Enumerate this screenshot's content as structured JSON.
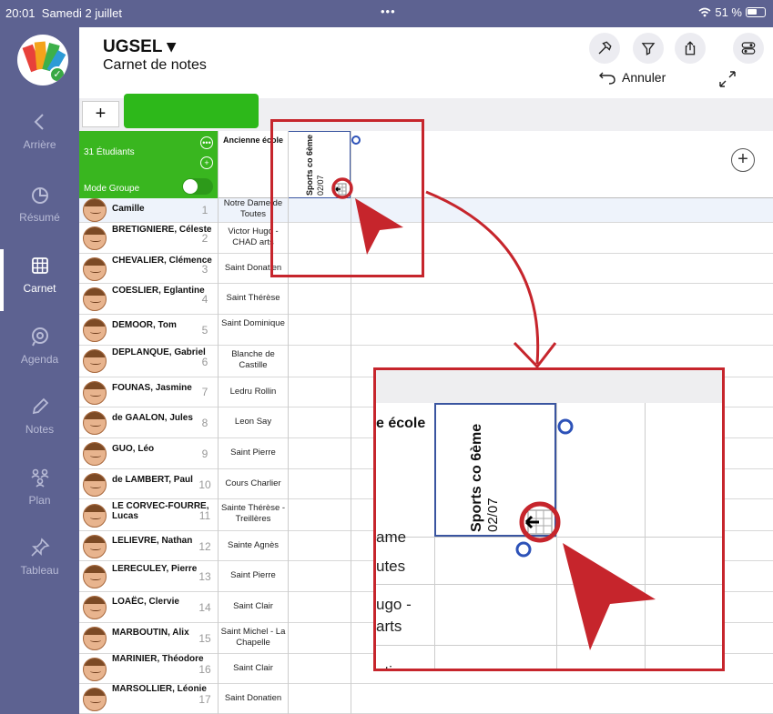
{
  "status_bar": {
    "time": "20:01",
    "date": "Samedi 2 juillet",
    "dots": "•••",
    "battery": "51 %"
  },
  "sidebar": {
    "items": [
      {
        "label": "Arrière",
        "icon": "chevron-left-icon"
      },
      {
        "label": "Résumé",
        "icon": "pie-chart-icon"
      },
      {
        "label": "Carnet",
        "icon": "grid-icon"
      },
      {
        "label": "Agenda",
        "icon": "agenda-icon"
      },
      {
        "label": "Notes",
        "icon": "pencil-icon"
      },
      {
        "label": "Plan",
        "icon": "people-icon"
      },
      {
        "label": "Tableau",
        "icon": "pin-icon"
      }
    ]
  },
  "header": {
    "title": "UGSEL ▾",
    "subtitle": "Carnet de notes",
    "undo_label": "Annuler"
  },
  "toolbar": {
    "plus": "+"
  },
  "group_panel": {
    "count": "31 Étudiants",
    "mode": "Mode Groupe",
    "more": "•••",
    "add": "+"
  },
  "columns": {
    "school_header": "Ancienne école",
    "assignment_title": "Sports co 6ème",
    "assignment_date": "02/07",
    "add_column": "+"
  },
  "students": [
    {
      "name": "Camille",
      "num": "1",
      "school": "Notre Dame de Toutes"
    },
    {
      "name": "BRETIGNIERE, Céleste",
      "num": "2",
      "school": "Victor Hugo - CHAD arts"
    },
    {
      "name": "CHEVALIER, Clémence",
      "num": "3",
      "school": "Saint Donatien"
    },
    {
      "name": "COESLIER, Eglantine",
      "num": "4",
      "school": "Saint Thérèse"
    },
    {
      "name": "DEMOOR, Tom",
      "num": "5",
      "school": "Saint Dominique"
    },
    {
      "name": "DEPLANQUE, Gabriel",
      "num": "6",
      "school": "Blanche de Castille"
    },
    {
      "name": "FOUNAS, Jasmine",
      "num": "7",
      "school": "Ledru Rollin"
    },
    {
      "name": "de GAALON, Jules",
      "num": "8",
      "school": "Leon Say"
    },
    {
      "name": "GUO, Léo",
      "num": "9",
      "school": "Saint Pierre"
    },
    {
      "name": "de LAMBERT, Paul",
      "num": "10",
      "school": "Cours Charlier"
    },
    {
      "name": "LE CORVEC-FOURRE, Lucas",
      "num": "11",
      "school": "Sainte Thérèse - Treillères"
    },
    {
      "name": "LELIEVRE, Nathan",
      "num": "12",
      "school": "Sainte Agnès"
    },
    {
      "name": "LERECULEY, Pierre",
      "num": "13",
      "school": "Saint Pierre"
    },
    {
      "name": "LOAËC, Clervie",
      "num": "14",
      "school": "Saint Clair"
    },
    {
      "name": "MARBOUTIN, Alix",
      "num": "15",
      "school": "Saint Michel - La Chapelle"
    },
    {
      "name": "MARINIER, Théodore",
      "num": "16",
      "school": "Saint Clair"
    },
    {
      "name": "MARSOLLIER, Léonie",
      "num": "17",
      "school": "Saint Donatien"
    }
  ],
  "zoom": {
    "school_header": "e école",
    "row1": "ame",
    "row1b": "utes",
    "row2": "ugo -",
    "row2b": "arts",
    "row3": "ntion"
  },
  "colors": {
    "sidebar": "#5d6291",
    "green": "#39b61f",
    "callout": "#c6252c",
    "column_border": "#3a55a0"
  }
}
